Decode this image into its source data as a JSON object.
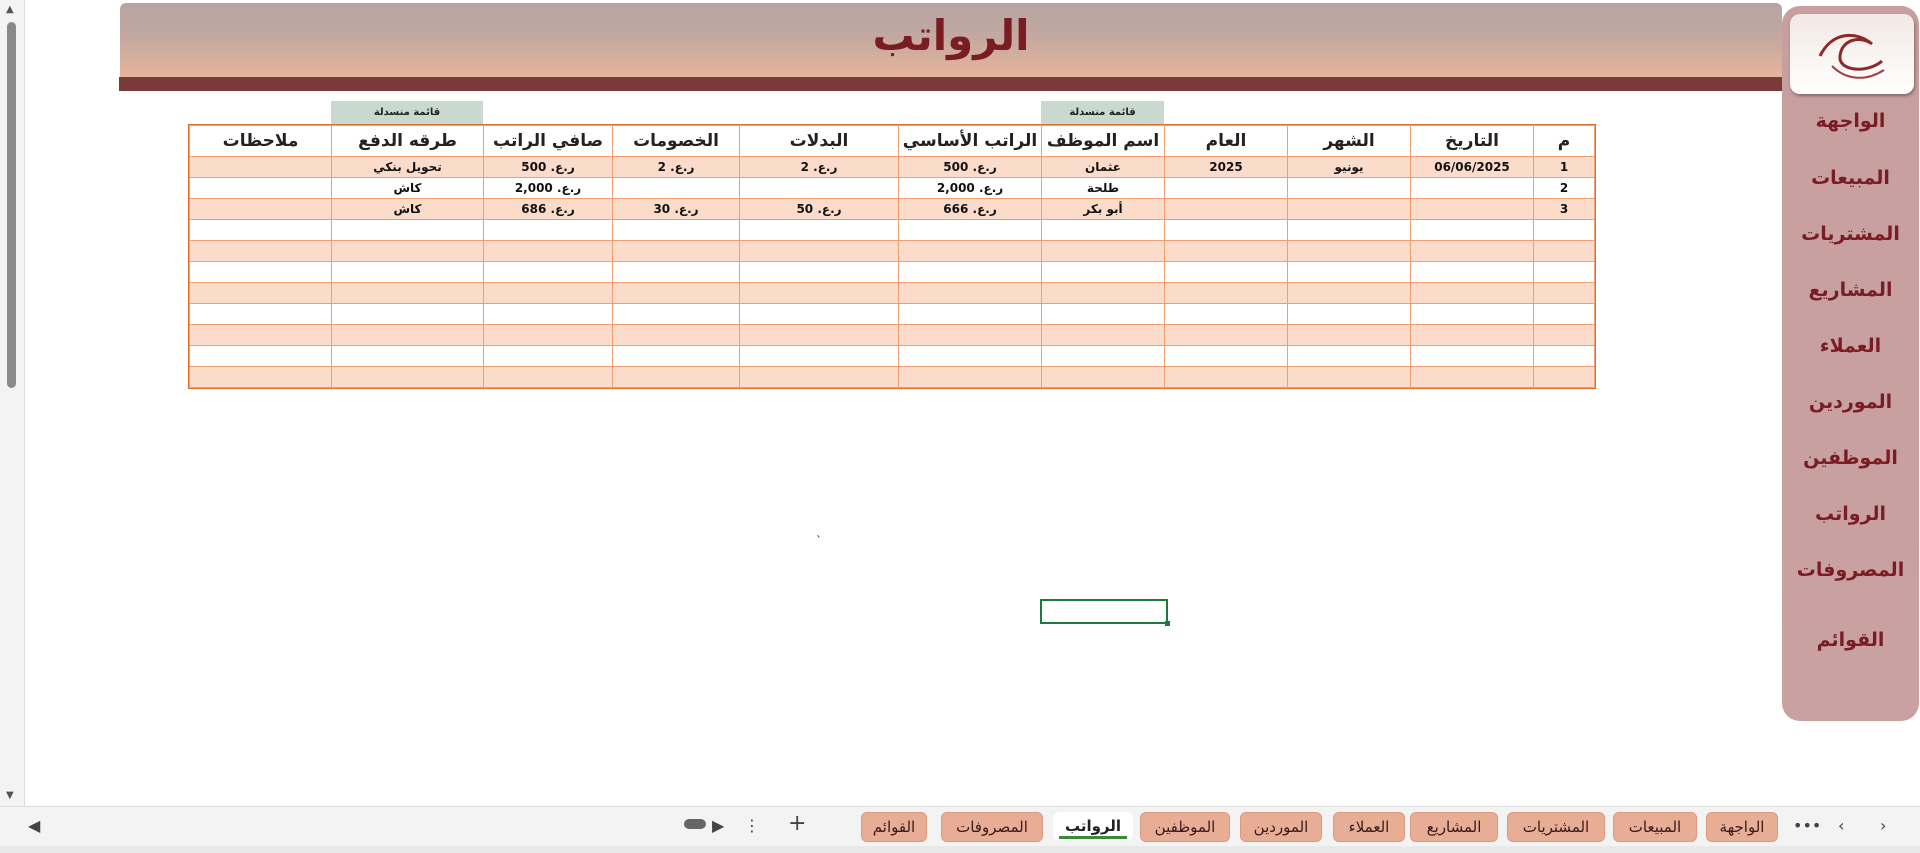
{
  "banner": {
    "title": "الرواتب"
  },
  "sidenav": {
    "items": [
      "الواجهة",
      "المبيعات",
      "المشتريات",
      "المشاريع",
      "العملاء",
      "الموردين",
      "الموظفين",
      "الرواتب",
      "المصروفات",
      "القوائم"
    ]
  },
  "badges": {
    "employee_list": "قائمة منسدلة",
    "payment_list": "قائمة منسدلة"
  },
  "table": {
    "headers": [
      "م",
      "التاريخ",
      "الشهر",
      "العام",
      "اسم الموظف",
      "الراتب الأساسي",
      "البدلات",
      "الخصومات",
      "صافي الراتب",
      "طرقه الدفع",
      "ملاحظات"
    ],
    "rows": [
      [
        "1",
        "06/06/2025",
        "يونيو",
        "2025",
        "عثمان",
        "ر.ع. 500",
        "ر.ع. 2",
        "ر.ع. 2",
        "ر.ع. 500",
        "تحويل بنكي",
        ""
      ],
      [
        "2",
        "",
        "",
        "",
        "طلحة",
        "ر.ع. 2,000",
        "",
        "",
        "ر.ع. 2,000",
        "كاش",
        ""
      ],
      [
        "3",
        "",
        "",
        "",
        "أبو بكر",
        "ر.ع. 666",
        "ر.ع. 50",
        "ر.ع. 30",
        "ر.ع. 686",
        "كاش",
        ""
      ],
      [
        "",
        "",
        "",
        "",
        "",
        "",
        "",
        "",
        "",
        "",
        ""
      ],
      [
        "",
        "",
        "",
        "",
        "",
        "",
        "",
        "",
        "",
        "",
        ""
      ],
      [
        "",
        "",
        "",
        "",
        "",
        "",
        "",
        "",
        "",
        "",
        ""
      ],
      [
        "",
        "",
        "",
        "",
        "",
        "",
        "",
        "",
        "",
        "",
        ""
      ],
      [
        "",
        "",
        "",
        "",
        "",
        "",
        "",
        "",
        "",
        "",
        ""
      ],
      [
        "",
        "",
        "",
        "",
        "",
        "",
        "",
        "",
        "",
        "",
        ""
      ],
      [
        "",
        "",
        "",
        "",
        "",
        "",
        "",
        "",
        "",
        "",
        ""
      ],
      [
        "",
        "",
        "",
        "",
        "",
        "",
        "",
        "",
        "",
        "",
        ""
      ]
    ]
  },
  "sheet_tabs": [
    "الواجهة",
    "المبيعات",
    "المشتريات",
    "المشاريع",
    "العملاء",
    "الموردين",
    "الموظفين",
    "الرواتب",
    "المصروفات",
    "القوائم"
  ],
  "active_sheet": "الرواتب",
  "colors": {
    "accent": "#7a1c24",
    "nav": "#c79f9f",
    "row_fill": "#fbdccb",
    "border": "#f0a070"
  },
  "icons": [
    "chevron-left-icon",
    "chevron-right-icon",
    "more-icon",
    "add-sheet-icon",
    "options-icon",
    "scroll-left-icon",
    "scroll-right-icon"
  ]
}
